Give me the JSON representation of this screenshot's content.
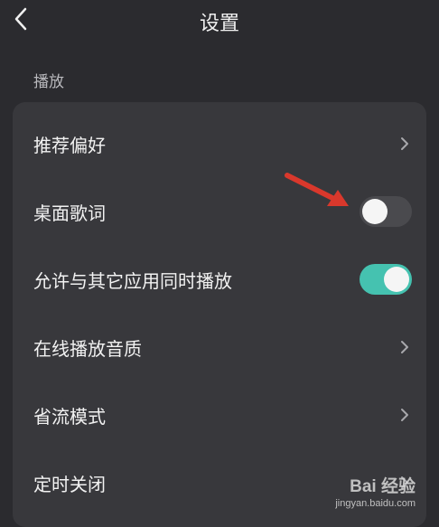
{
  "header": {
    "title": "设置",
    "back_icon": "chevron-left-icon"
  },
  "section": {
    "label": "播放"
  },
  "rows": [
    {
      "label": "推荐偏好",
      "control": "chevron"
    },
    {
      "label": "桌面歌词",
      "control": "toggle",
      "on": false
    },
    {
      "label": "允许与其它应用同时播放",
      "control": "toggle",
      "on": true
    },
    {
      "label": "在线播放音质",
      "control": "chevron"
    },
    {
      "label": "省流模式",
      "control": "chevron"
    },
    {
      "label": "定时关闭",
      "control": "chevron"
    }
  ],
  "colors": {
    "background": "#2b2b2f",
    "card": "#38383c",
    "toggle_on": "#45c2b0",
    "toggle_off": "#4a4a4e",
    "annotation_arrow": "#d9382c"
  },
  "watermark": {
    "logo": "Bai 经验",
    "url": "jingyan.baidu.com"
  }
}
